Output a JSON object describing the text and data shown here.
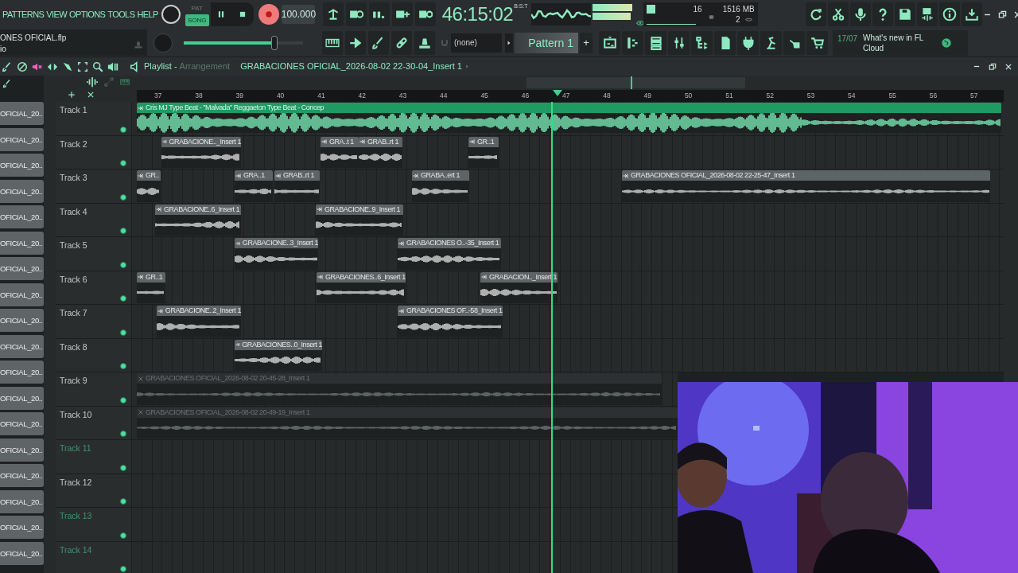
{
  "menu": [
    "PATTERNS",
    "VIEW",
    "OPTIONS",
    "TOOLS",
    "HELP"
  ],
  "transport": {
    "modes": [
      {
        "label": "PAT",
        "selected": false
      },
      {
        "label": "SONG",
        "selected": true
      }
    ],
    "tempo": "100.000",
    "time_format": "B:S:T",
    "time": "46:15:02"
  },
  "monitor": {
    "cpu": "16",
    "memory": "1516 MB",
    "polyphony": "2"
  },
  "project": {
    "file": "ONES OFICIAL.flp",
    "line_2": "io"
  },
  "master_volume": {
    "level": 0.76
  },
  "pattern_picker": {
    "value": "(none)"
  },
  "pattern": {
    "name": "Pattern 1",
    "add": "+"
  },
  "news": {
    "date": "17/07",
    "text": "What's new in FL Cloud"
  },
  "playlist": {
    "title": "Playlist -",
    "view": "Arrangement",
    "clip": "GRABACIONES OFICIAL_2026-08-02 22-30-04_Insert 1"
  },
  "browser": {
    "items": [
      "OFICIAL_20..",
      "OFICIAL_20..",
      "OFICIAL_20..",
      "OFICIAL_20..",
      "OFICIAL_20..",
      "OFICIAL_20..",
      "OFICIAL_20..",
      "OFICIAL_20..",
      "OFICIAL_20..",
      "OFICIAL_20..",
      "OFICIAL_20..",
      "OFICIAL_20..",
      "OFICIAL_20..",
      "OFICIAL_20..",
      "OFICIAL_20..",
      "OFICIAL_20..",
      "OFICIAL_20..",
      "OFICIAL_20.."
    ]
  },
  "ruler": [
    "37",
    "38",
    "39",
    "40",
    "41",
    "42",
    "43",
    "44",
    "45",
    "46",
    "47",
    "48",
    "49",
    "50",
    "51",
    "52",
    "53",
    "54",
    "55",
    "56",
    "57"
  ],
  "tracks": [
    {
      "name": "Track 1",
      "color": "#c8c8c8",
      "clips": [
        {
          "title": "Cris MJ Type Beat - \"Malvada\" Reggaeton Type Beat - Concep",
          "kind": "beat"
        }
      ]
    },
    {
      "name": "Track 2",
      "color": "#c8c8c8",
      "clips": [
        {
          "title": "GRABACIONE.._Insert 1",
          "kind": "audio"
        },
        {
          "title": "GRA..t 1",
          "kind": "audio"
        },
        {
          "title": "GRAB..rt 1",
          "kind": "audio"
        },
        {
          "title": "GR..1",
          "kind": "audio"
        }
      ]
    },
    {
      "name": "Track 3",
      "color": "#c8c8c8",
      "clips": [
        {
          "title": "GR..",
          "kind": "audio"
        },
        {
          "title": "GRA..1",
          "kind": "audio"
        },
        {
          "title": "GRAB..rt 1",
          "kind": "audio"
        },
        {
          "title": "GRABA..ert 1",
          "kind": "audio"
        },
        {
          "title": "GRABACIONES OFICIAL_2026-08-02 22-25-47_Insert 1",
          "kind": "audio"
        }
      ]
    },
    {
      "name": "Track 4",
      "color": "#c8c8c8",
      "clips": [
        {
          "title": "GRABACIONE..6_Insert 1",
          "kind": "audio"
        },
        {
          "title": "GRABACIONE..9_Insert 1",
          "kind": "audio"
        }
      ]
    },
    {
      "name": "Track 5",
      "color": "#c8c8c8",
      "clips": [
        {
          "title": "GRABACIONE..3_Insert 1",
          "kind": "audio"
        },
        {
          "title": "GRABACIONES O..-35_Insert 1",
          "kind": "audio"
        }
      ]
    },
    {
      "name": "Track 6",
      "color": "#c8c8c8",
      "clips": [
        {
          "title": "GR..1",
          "kind": "audio"
        },
        {
          "title": "GRABACIONES..6_Insert 1",
          "kind": "audio"
        },
        {
          "title": "GRABACION.._Insert 1",
          "kind": "audio"
        }
      ]
    },
    {
      "name": "Track 7",
      "color": "#c8c8c8",
      "clips": [
        {
          "title": "GRABACIONE..2_Insert 1",
          "kind": "audio"
        },
        {
          "title": "GRABACIONES OF..-58_Insert 1",
          "kind": "audio"
        }
      ]
    },
    {
      "name": "Track 8",
      "color": "#c8c8c8",
      "clips": [
        {
          "title": "GRABACIONES..0_Insert 1",
          "kind": "audio"
        }
      ]
    },
    {
      "name": "Track 9",
      "color": "#c8c8c8",
      "clips": [
        {
          "title": "GRABACIONES OFICIAL_2026-08-02 20-45-28_Insert 1",
          "kind": "muted"
        }
      ]
    },
    {
      "name": "Track 10",
      "color": "#c8c8c8",
      "clips": [
        {
          "title": "GRABACIONES OFICIAL_2026-08-02 20-49-19_Insert 1",
          "kind": "muted"
        }
      ]
    },
    {
      "name": "Track 11",
      "color": "#3f9470"
    },
    {
      "name": "Track 12",
      "color": "#c8c8c8"
    },
    {
      "name": "Track 13",
      "color": "#3f9470"
    },
    {
      "name": "Track 14",
      "color": "#3f9470"
    }
  ]
}
